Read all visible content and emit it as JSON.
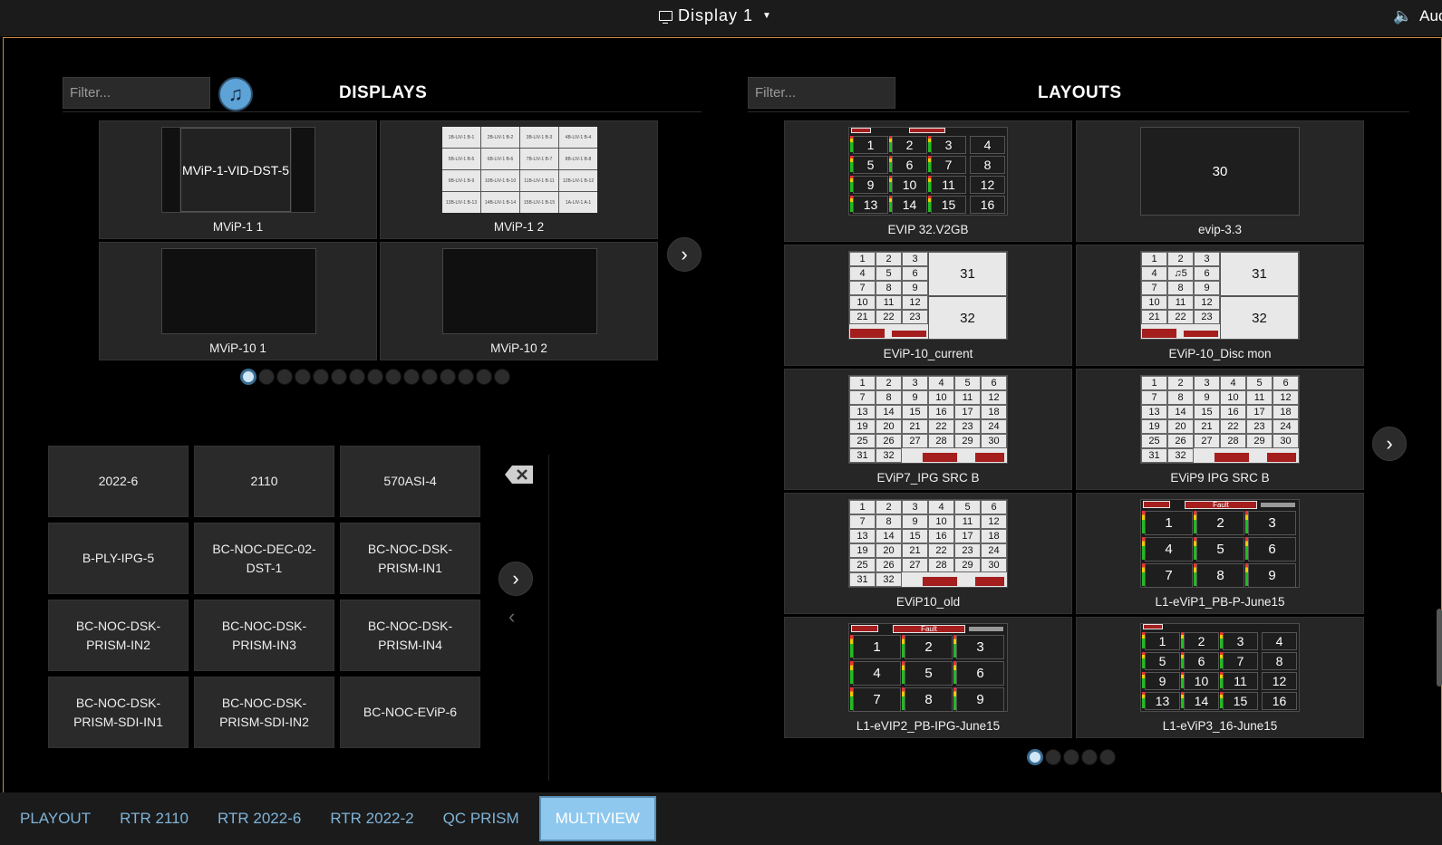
{
  "topbar": {
    "display_label": "Display 1",
    "audio_label": "Audio"
  },
  "displays": {
    "title": "DISPLAYS",
    "filter_placeholder": "Filter...",
    "cards": [
      {
        "label": "MViP-1 1",
        "inner": "MViP-1-VID-DST-5"
      },
      {
        "label": "MViP-1 2"
      },
      {
        "label": "MViP-10 1"
      },
      {
        "label": "MViP-10 2"
      }
    ],
    "grid_cells": [
      "1B-LIV-1 B-1",
      "2B-LIV-1 B-2",
      "3B-LIV-1 B-3",
      "4B-LIV-1 B-4",
      "5B-LIV-1 B-5",
      "6B-LIV-1 B-6",
      "7B-LIV-1 B-7",
      "8B-LIV-1 B-8",
      "9B-LIV-1 B-9",
      "10B-LIV-1 B-10",
      "11B-LIV-1 B-11",
      "12B-LIV-1 B-12",
      "13B-LIV-1 B-13",
      "14B-LIV-1 B-14",
      "15B-LIV-1 B-15",
      "1A-LIV-1 A-1"
    ],
    "page_count": 15,
    "current_page": 1
  },
  "sources": {
    "items": [
      "2022-6",
      "2110",
      "570ASI-4",
      "B-PLY-IPG-5",
      "BC-NOC-DEC-02-DST-1",
      "BC-NOC-DSK-PRISM-IN1",
      "BC-NOC-DSK-PRISM-IN2",
      "BC-NOC-DSK-PRISM-IN3",
      "BC-NOC-DSK-PRISM-IN4",
      "BC-NOC-DSK-PRISM-SDI-IN1",
      "BC-NOC-DSK-PRISM-SDI-IN2",
      "BC-NOC-EViP-6"
    ]
  },
  "layouts": {
    "title": "LAYOUTS",
    "filter_placeholder": "Filter...",
    "cards": [
      {
        "label": "EVIP 32.V2GB"
      },
      {
        "label": "evip-3.3",
        "inner": "30"
      },
      {
        "label": "EViP-10_current"
      },
      {
        "label": "EViP-10_Disc mon"
      },
      {
        "label": "EViP7_IPG SRC B"
      },
      {
        "label": "EViP9 IPG SRC B"
      },
      {
        "label": "EViP10_old"
      },
      {
        "label": "L1-eViP1_PB-P-June15"
      },
      {
        "label": "L1-eVIP2_PB-IPG-June15"
      },
      {
        "label": "L1-eViP3_16-June15"
      }
    ],
    "fault_text": "Fault",
    "page_count": 5,
    "current_page": 1
  },
  "tabs": [
    {
      "label": "PLAYOUT"
    },
    {
      "label": "RTR 2110"
    },
    {
      "label": "RTR 2022-6"
    },
    {
      "label": "RTR 2022-2"
    },
    {
      "label": "QC PRISM"
    },
    {
      "label": "MULTIVIEW",
      "active": true
    }
  ],
  "colors": {
    "accent": "#8fc8ee",
    "tab_text": "#7fb3d8",
    "border_orange": "#c98a3d",
    "fault": "#a51e1e"
  }
}
